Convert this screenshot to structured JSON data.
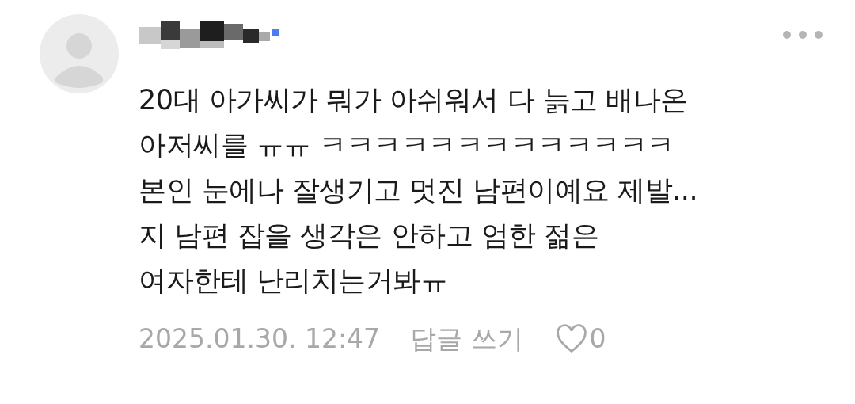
{
  "comment": {
    "text": "20대 아가씨가 뭐가 아쉬워서 다 늙고 배나온\n아저씨를 ㅠㅠ ㅋㅋㅋㅋㅋㅋㅋㅋㅋㅋㅋㅋㅋ\n본인 눈에나 잘생기고 멋진 남편이예요 제발...\n지 남편 잡을 생각은 안하고 엄한 젊은\n여자한테 난리치는거봐ㅠ",
    "date": "2025.01.30. 12:47",
    "reply": "답글 쓰기",
    "likes": "0"
  }
}
